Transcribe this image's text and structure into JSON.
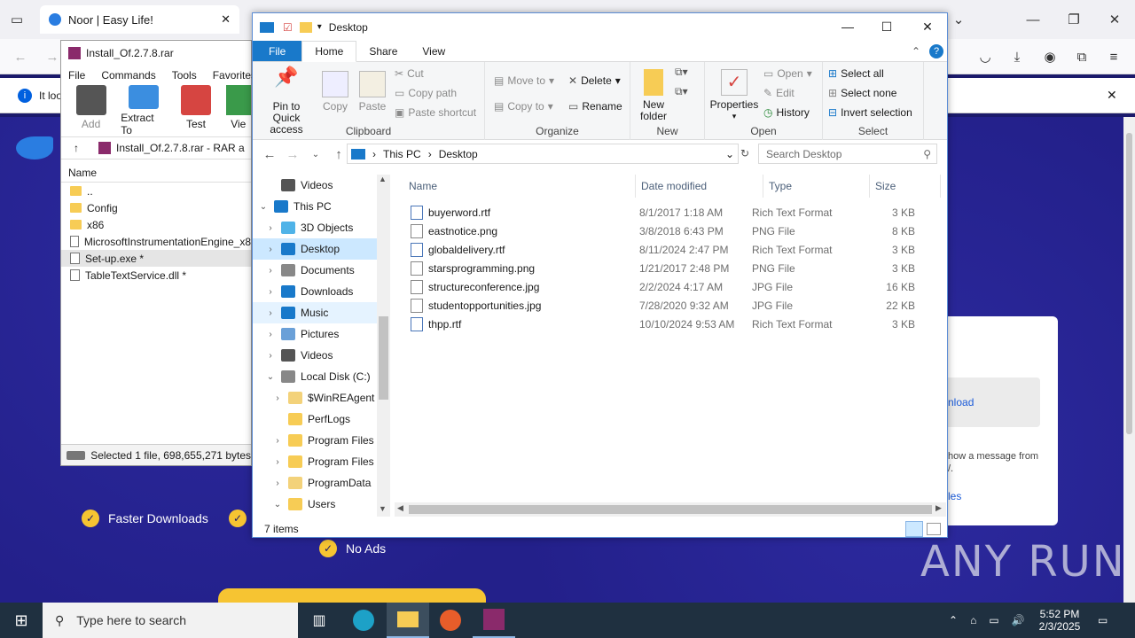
{
  "browser": {
    "tabs": [
      {
        "title": "Noor | Easy Life!"
      }
    ],
    "notice_text": "It loo",
    "features": [
      "Faster Downloads",
      "No Ads"
    ],
    "card_link": "nload",
    "card_text": "how a message from",
    "card_text2": "/.",
    "card_link2": "les",
    "watermark": "ANY RUN"
  },
  "winrar": {
    "title": "Install_Of.2.7.8.rar",
    "menu": [
      "File",
      "Commands",
      "Tools",
      "Favorites"
    ],
    "toolbar": [
      "Add",
      "Extract To",
      "Test",
      "Vie"
    ],
    "path": "Install_Of.2.7.8.rar - RAR a",
    "column_name": "Name",
    "files": [
      {
        "name": "..",
        "type": "folder"
      },
      {
        "name": "Config",
        "type": "folder"
      },
      {
        "name": "x86",
        "type": "folder"
      },
      {
        "name": "MicrosoftInstrumentationEngine_x8",
        "type": "file"
      },
      {
        "name": "Set-up.exe *",
        "type": "file",
        "selected": true
      },
      {
        "name": "TableTextService.dll *",
        "type": "file"
      }
    ],
    "status": "Selected 1 file, 698,655,271 bytes"
  },
  "explorer": {
    "title": "Desktop",
    "ribbon_tabs": [
      "File",
      "Home",
      "Share",
      "View"
    ],
    "clipboard": {
      "pin": "Pin to Quick access",
      "copy": "Copy",
      "paste": "Paste",
      "cut": "Cut",
      "copy_path": "Copy path",
      "paste_shortcut": "Paste shortcut",
      "label": "Clipboard"
    },
    "organize": {
      "move_to": "Move to",
      "copy_to": "Copy to",
      "delete": "Delete",
      "rename": "Rename",
      "label": "Organize"
    },
    "new": {
      "new_folder": "New folder",
      "label": "New"
    },
    "open": {
      "properties": "Properties",
      "open": "Open",
      "edit": "Edit",
      "history": "History",
      "label": "Open"
    },
    "select": {
      "select_all": "Select all",
      "select_none": "Select none",
      "invert": "Invert selection",
      "label": "Select"
    },
    "breadcrumb": [
      "This PC",
      "Desktop"
    ],
    "search_placeholder": "Search Desktop",
    "nav": [
      {
        "label": "Videos",
        "indent": 1,
        "chev": "",
        "color": "#555"
      },
      {
        "label": "This PC",
        "indent": 0,
        "chev": "⌄",
        "color": "#1979ca"
      },
      {
        "label": "3D Objects",
        "indent": 1,
        "chev": "›",
        "color": "#4fb3e8"
      },
      {
        "label": "Desktop",
        "indent": 1,
        "chev": "›",
        "color": "#1979ca",
        "selected": true
      },
      {
        "label": "Documents",
        "indent": 1,
        "chev": "›",
        "color": "#888"
      },
      {
        "label": "Downloads",
        "indent": 1,
        "chev": "›",
        "color": "#1979ca"
      },
      {
        "label": "Music",
        "indent": 1,
        "chev": "›",
        "color": "#1979ca",
        "hover": true
      },
      {
        "label": "Pictures",
        "indent": 1,
        "chev": "›",
        "color": "#6aa0d8"
      },
      {
        "label": "Videos",
        "indent": 1,
        "chev": "›",
        "color": "#555"
      },
      {
        "label": "Local Disk (C:)",
        "indent": 1,
        "chev": "⌄",
        "color": "#888"
      },
      {
        "label": "$WinREAgent",
        "indent": 2,
        "chev": "›",
        "color": "#f3d27a"
      },
      {
        "label": "PerfLogs",
        "indent": 2,
        "chev": "",
        "color": "#f7cc55"
      },
      {
        "label": "Program Files",
        "indent": 2,
        "chev": "›",
        "color": "#f7cc55"
      },
      {
        "label": "Program Files",
        "indent": 2,
        "chev": "›",
        "color": "#f7cc55"
      },
      {
        "label": "ProgramData",
        "indent": 2,
        "chev": "›",
        "color": "#f3d27a"
      },
      {
        "label": "Users",
        "indent": 2,
        "chev": "⌄",
        "color": "#f7cc55"
      }
    ],
    "columns": [
      "Name",
      "Date modified",
      "Type",
      "Size"
    ],
    "files": [
      {
        "name": "buyerword.rtf",
        "date": "8/1/2017 1:18 AM",
        "type": "Rich Text Format",
        "size": "3 KB",
        "kind": "doc"
      },
      {
        "name": "eastnotice.png",
        "date": "3/8/2018 6:43 PM",
        "type": "PNG File",
        "size": "8 KB",
        "kind": "img"
      },
      {
        "name": "globaldelivery.rtf",
        "date": "8/11/2024 2:47 PM",
        "type": "Rich Text Format",
        "size": "3 KB",
        "kind": "doc"
      },
      {
        "name": "starsprogramming.png",
        "date": "1/21/2017 2:48 PM",
        "type": "PNG File",
        "size": "3 KB",
        "kind": "img"
      },
      {
        "name": "structureconference.jpg",
        "date": "2/2/2024 4:17 AM",
        "type": "JPG File",
        "size": "16 KB",
        "kind": "img"
      },
      {
        "name": "studentopportunities.jpg",
        "date": "7/28/2020 9:32 AM",
        "type": "JPG File",
        "size": "22 KB",
        "kind": "img"
      },
      {
        "name": "thpp.rtf",
        "date": "10/10/2024 9:53 AM",
        "type": "Rich Text Format",
        "size": "3 KB",
        "kind": "doc"
      }
    ],
    "status": "7 items"
  },
  "taskbar": {
    "search_placeholder": "Type here to search",
    "time": "5:52 PM",
    "date": "2/3/2025"
  }
}
